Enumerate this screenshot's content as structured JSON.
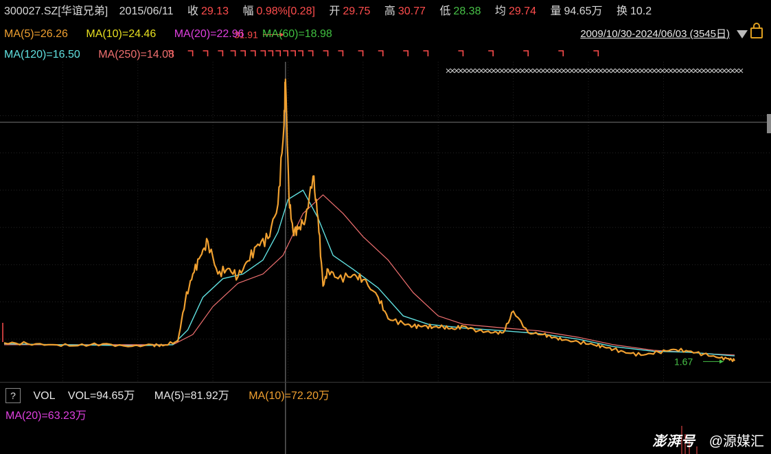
{
  "header": {
    "code": "300027.SZ[华谊兄弟]",
    "date": "2015/06/11",
    "close_label": "收",
    "close": "29.13",
    "change_label": "幅",
    "change": "0.98%[0.28]",
    "open_label": "开",
    "open": "29.75",
    "high_label": "高",
    "high": "30.77",
    "low_label": "低",
    "low": "28.38",
    "avg_label": "均",
    "avg": "29.74",
    "vol_label": "量",
    "vol": "94.65万",
    "turnover_label": "换",
    "turnover": "10.2"
  },
  "ma": {
    "ma5": "MA(5)=26.26",
    "ma10": "MA(10)=24.46",
    "ma20": "MA(20)=22.96",
    "ma60": "MA(60)=18.98",
    "ma120": "MA(120)=16.50",
    "ma250": "MA(250)=14.08"
  },
  "range": "2009/10/30-2024/06/03 (3545日)",
  "volume_panel": {
    "help": "?",
    "title": "VOL",
    "vol": "VOL=94.65万",
    "ma5": "MA(5)=81.92万",
    "ma10": "MA(10)=72.20万",
    "ma20": "MA(20)=63.23万"
  },
  "watermark": {
    "brand": "澎湃号",
    "author": "@源媒汇"
  },
  "colors": {
    "background": "#000000",
    "price": "#f0a030",
    "ma5": "#f0a030",
    "ma10": "#e8e020",
    "ma20": "#e040e0",
    "ma60": "#40c040",
    "ma120": "#60e0e0",
    "ma250": "#f07070",
    "up": "#ff4d4d",
    "down": "#47c147"
  },
  "chart_data": {
    "type": "line",
    "x_range": [
      "2009/10/30",
      "2024/06/03"
    ],
    "ylim": [
      0,
      36
    ],
    "high_annotation": {
      "label": "31.91",
      "value": 31.91,
      "date": "2015/06"
    },
    "low_annotation": {
      "label": "1.67",
      "value": 1.67,
      "date": "2024/05"
    },
    "series": [
      {
        "key": "price",
        "x": [
          2009.83,
          2010.3,
          2010.8,
          2011.3,
          2011.8,
          2012.3,
          2012.8,
          2013.0,
          2013.3,
          2013.45,
          2013.6,
          2013.75,
          2013.9,
          2014.1,
          2014.3,
          2014.5,
          2014.7,
          2014.9,
          2015.1,
          2015.3,
          2015.42,
          2015.45,
          2015.52,
          2015.6,
          2015.7,
          2015.85,
          2016.0,
          2016.1,
          2016.2,
          2016.3,
          2016.5,
          2016.8,
          2017.0,
          2017.3,
          2017.5,
          2017.8,
          2018.0,
          2018.2,
          2018.4,
          2018.6,
          2018.8,
          2019.0,
          2019.3,
          2019.6,
          2019.8,
          2020.0,
          2020.3,
          2020.6,
          2020.8,
          2021.0,
          2021.3,
          2021.6,
          2021.8,
          2022.0,
          2022.3,
          2022.6,
          2022.9,
          2023.2,
          2023.5,
          2023.8,
          2024.1,
          2024.3,
          2024.42
        ],
        "y": [
          3.6,
          3.5,
          3.4,
          3.3,
          3.5,
          3.2,
          3.4,
          3.3,
          3.8,
          8.2,
          11.0,
          12.9,
          14.5,
          11.0,
          11.6,
          10.7,
          12.4,
          14.2,
          14.8,
          18.5,
          27.0,
          31.91,
          19.0,
          15.6,
          15.8,
          16.9,
          21.5,
          17.0,
          9.7,
          11.5,
          10.5,
          10.9,
          10.4,
          8.5,
          6.2,
          5.7,
          5.4,
          5.4,
          5.3,
          5.3,
          5.1,
          5.4,
          4.9,
          4.7,
          4.7,
          7.0,
          4.7,
          4.5,
          4.2,
          3.9,
          3.7,
          3.4,
          3.2,
          2.9,
          2.5,
          2.3,
          2.6,
          2.9,
          2.7,
          2.4,
          2.0,
          1.9,
          1.67
        ]
      },
      {
        "key": "ma120",
        "x": [
          2009.83,
          2011.0,
          2012.5,
          2013.2,
          2013.5,
          2013.8,
          2014.2,
          2014.6,
          2015.0,
          2015.3,
          2015.5,
          2015.8,
          2016.1,
          2016.4,
          2016.8,
          2017.3,
          2017.8,
          2018.3,
          2019.0,
          2019.8,
          2020.5,
          2021.3,
          2022.0,
          2022.8,
          2023.5,
          2024.42
        ],
        "y": [
          3.5,
          3.4,
          3.3,
          3.4,
          5.0,
          8.5,
          10.5,
          11.0,
          12.5,
          15.5,
          19.0,
          20.0,
          17.0,
          13.0,
          11.5,
          9.5,
          6.5,
          5.6,
          5.2,
          4.9,
          4.6,
          4.0,
          3.2,
          2.7,
          2.6,
          2.2
        ]
      },
      {
        "key": "ma250",
        "x": [
          2009.83,
          2011.0,
          2012.5,
          2013.2,
          2013.6,
          2014.0,
          2014.5,
          2015.0,
          2015.4,
          2015.8,
          2016.2,
          2016.6,
          2017.0,
          2017.5,
          2018.0,
          2018.5,
          2019.0,
          2019.8,
          2020.5,
          2021.3,
          2022.0,
          2022.8,
          2023.5,
          2024.0,
          2024.42
        ],
        "y": [
          3.4,
          3.4,
          3.4,
          3.4,
          4.5,
          7.5,
          10.0,
          11.0,
          13.0,
          17.5,
          19.5,
          17.5,
          15.0,
          12.5,
          9.0,
          6.5,
          5.6,
          5.2,
          4.9,
          4.2,
          3.4,
          2.8,
          2.6,
          2.4,
          2.3
        ]
      }
    ]
  }
}
